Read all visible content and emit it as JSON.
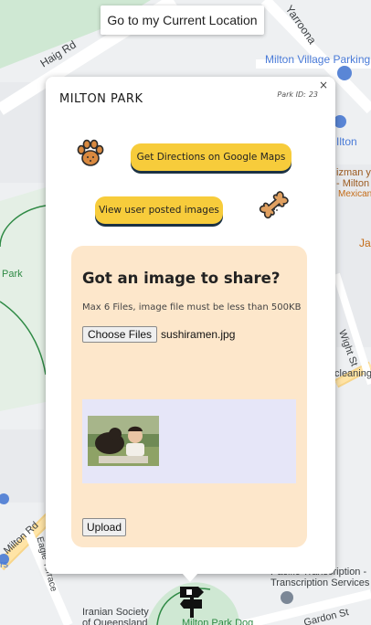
{
  "top_button": {
    "label": "Go to my Current Location"
  },
  "map": {
    "labels": {
      "haig_rd": "Haig Rd",
      "yarroona": "Yarroona",
      "milton_village_parking": "Milton Village Parking",
      "ilton": "Ilton",
      "izman": "izman y",
      "milton_frag": "- Milton",
      "mexican": "Mexican",
      "jap": "Jap",
      "park": "Park",
      "wight_st": "Wight St",
      "cleaning": "cleaning",
      "milton_rd": "Milton Rd",
      "eagle_terrace": "Eagle Terrace",
      "rs": "rs",
      "pacific_transcription": "Pacific Transcription -",
      "transcription_services": "Transcription Services",
      "iranian_society": "Iranian Society",
      "of_queensland": "of Queensland",
      "milton_park_dog": "Milton Park Dog",
      "gardon_st": "Gardon St"
    }
  },
  "info_window": {
    "close_label": "×",
    "park_name": "MILTON PARK",
    "park_id_label": "Park ID:",
    "park_id_value": "23",
    "directions_button": "Get Directions on Google Maps",
    "images_button": "View user posted images",
    "upload_card": {
      "title": "Got an image to share?",
      "note": "Max 6 Files, image file must be less than 500KB",
      "choose_files_label": "Choose Files",
      "file_name": "sushiramen.jpg",
      "upload_label": "Upload"
    }
  },
  "colors": {
    "pill": "#f7cc3b",
    "pill_shadow": "#1c3244",
    "card": "#fde7cb",
    "preview": "#e6e6f8"
  }
}
